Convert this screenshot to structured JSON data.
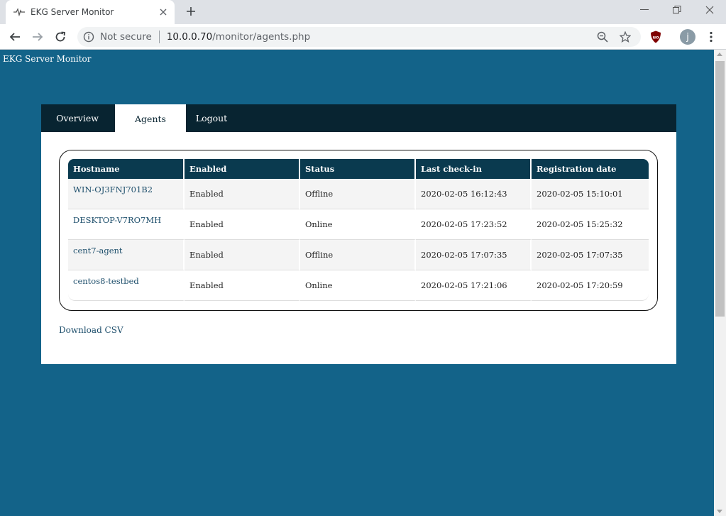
{
  "browser": {
    "tab_title": "EKG Server Monitor",
    "not_secure": "Not secure",
    "url_host": "10.0.0.70",
    "url_path": "/monitor/agents.php",
    "profile_initial": "j",
    "extension_label": "uo"
  },
  "page": {
    "site_title": "EKG Server Monitor",
    "nav": [
      {
        "label": "Overview"
      },
      {
        "label": "Agents"
      },
      {
        "label": "Logout"
      }
    ],
    "table": {
      "headers": [
        "Hostname",
        "Enabled",
        "Status",
        "Last check-in",
        "Registration date"
      ],
      "rows": [
        {
          "hostname": "WIN-OJ3FNJ701B2",
          "enabled": "Enabled",
          "status": "Offline",
          "last_checkin": "2020-02-05 16:12:43",
          "registered": "2020-02-05 15:10:01"
        },
        {
          "hostname": "DESKTOP-V7RO7MH",
          "enabled": "Enabled",
          "status": "Online",
          "last_checkin": "2020-02-05 17:23:52",
          "registered": "2020-02-05 15:25:32"
        },
        {
          "hostname": "cent7-agent",
          "enabled": "Enabled",
          "status": "Offline",
          "last_checkin": "2020-02-05 17:07:35",
          "registered": "2020-02-05 17:07:35"
        },
        {
          "hostname": "centos8-testbed",
          "enabled": "Enabled",
          "status": "Online",
          "last_checkin": "2020-02-05 17:21:06",
          "registered": "2020-02-05 17:20:59"
        }
      ]
    },
    "download_label": "Download CSV"
  },
  "colors": {
    "page_bg": "#136389",
    "navbar_bg": "#082431",
    "table_header_bg": "#0a3a4f",
    "offline": "#c00000",
    "online": "#1a7a1a"
  }
}
